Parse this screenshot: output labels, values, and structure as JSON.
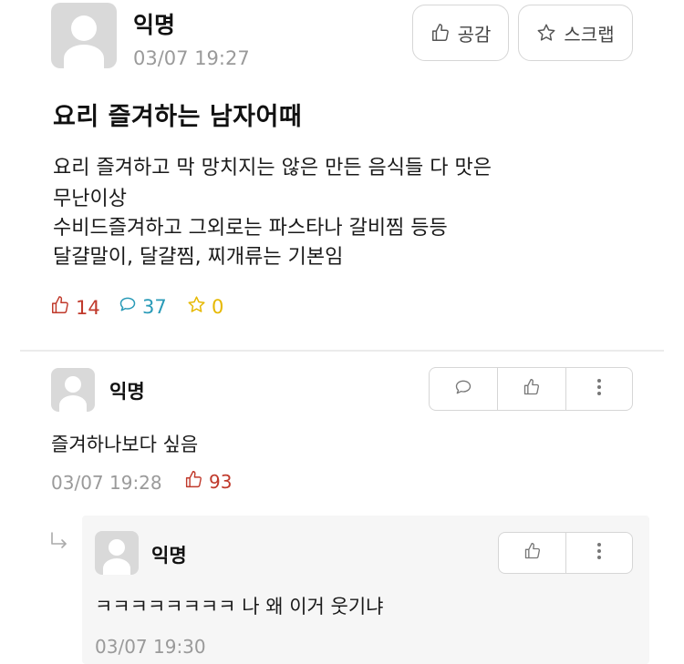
{
  "post": {
    "author": "익명",
    "time": "03/07 19:27",
    "buttons": {
      "like_label": "공감",
      "scrap_label": "스크랩"
    },
    "title": "요리 즐겨하는 남자어때",
    "body_lines": [
      "요리 즐겨하고 막 망치지는 않은 만든 음식들 다 맛은",
      "무난이상",
      "수비드즐겨하고 그외로는 파스타나 갈비찜 등등",
      "달걀말이, 달걀찜, 찌개류는 기본임"
    ],
    "stats": {
      "likes": "14",
      "comments": "37",
      "scraps": "0"
    }
  },
  "comments": [
    {
      "author": "익명",
      "text": "즐겨하나보다 싶음",
      "time": "03/07 19:28",
      "likes": "93"
    },
    {
      "author": "익명",
      "text": "ㅋㅋㅋㅋㅋㅋㅋㅋ 나 왜 이거 웃기냐",
      "time": "03/07 19:30"
    }
  ],
  "colors": {
    "like": "#c0392b",
    "comment": "#2a9bb8",
    "scrap": "#e6b800",
    "muted": "#9a9a9a"
  },
  "icons": {
    "thumb": "thumbs-up-icon",
    "bubble": "speech-bubble-icon",
    "star": "star-icon",
    "kebab": "more-vertical-icon",
    "reply": "reply-arrow-icon"
  }
}
